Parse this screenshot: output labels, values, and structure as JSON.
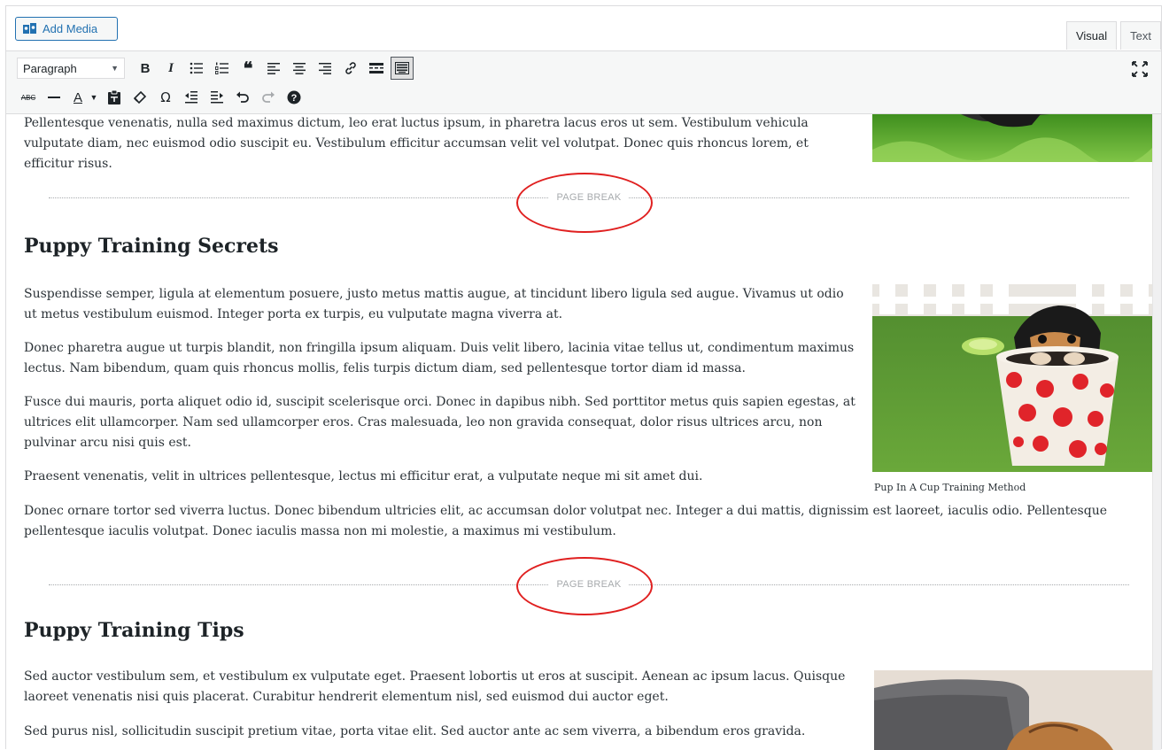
{
  "header": {
    "add_media_label": "Add Media",
    "tabs": [
      {
        "label": "Visual",
        "active": true
      },
      {
        "label": "Text",
        "active": false
      }
    ]
  },
  "toolbar": {
    "format_select": "Paragraph",
    "row1_icons": [
      "bold-icon",
      "italic-icon",
      "bulleted-list-icon",
      "numbered-list-icon",
      "blockquote-icon",
      "align-left-icon",
      "align-center-icon",
      "align-right-icon",
      "link-icon",
      "read-more-icon",
      "toolbar-toggle-icon"
    ],
    "row2_icons": [
      "strikethrough-icon",
      "horizontal-line-icon",
      "text-color-icon",
      "paste-as-text-icon",
      "clear-formatting-icon",
      "special-character-icon",
      "outdent-icon",
      "indent-icon",
      "undo-icon",
      "redo-icon",
      "help-icon"
    ],
    "bold": "B",
    "italic": "I",
    "strike": "ABC",
    "text_color": "A",
    "omega": "Ω",
    "help": "?"
  },
  "content": {
    "top_paragraph": "Pellentesque venenatis, nulla sed maximus dictum, leo erat luctus ipsum, in pharetra lacus eros ut sem. Vestibulum vehicula vulputate diam, nec euismod odio suscipit eu. Vestibulum efficitur accumsan velit vel volutpat. Donec quis rhoncus lorem, et efficitur risus.",
    "page_break_label": "PAGE BREAK",
    "section1": {
      "heading": "Puppy Training Secrets",
      "paragraphs": [
        "Suspendisse semper, ligula at elementum posuere, justo metus mattis augue, at tincidunt libero ligula sed augue. Vivamus ut odio ut metus vestibulum euismod. Integer porta ex turpis, eu vulputate magna viverra at.",
        "Donec pharetra augue ut turpis blandit, non fringilla ipsum aliquam. Duis velit libero, lacinia vitae tellus ut, condimentum maximus lectus. Nam bibendum, quam quis rhoncus mollis, felis turpis dictum diam, sed pellentesque tortor diam id massa.",
        "Fusce dui mauris, porta aliquet odio id, suscipit scelerisque orci. Donec in dapibus nibh. Sed porttitor metus quis sapien egestas, at ultrices elit ullamcorper. Nam sed ullamcorper eros. Cras malesuada, leo non gravida consequat, dolor risus ultrices arcu, non pulvinar arcu nisi quis est.",
        "Praesent venenatis, velit in ultrices pellentesque, lectus mi efficitur erat, a vulputate neque mi sit amet dui.",
        "Donec ornare tortor sed viverra luctus. Donec bibendum ultricies elit, ac accumsan dolor volutpat nec. Integer a dui mattis, dignissim est laoreet, iaculis odio. Pellentesque pellentesque iaculis volutpat. Donec iaculis massa non mi molestie, a maximus mi vestibulum."
      ],
      "image_caption": "Pup In A Cup Training Method"
    },
    "section2": {
      "heading": "Puppy Training Tips",
      "paragraphs": [
        "Sed auctor vestibulum sem, et vestibulum ex vulputate eget. Praesent lobortis ut eros at suscipit. Aenean ac ipsum lacus. Quisque laoreet venenatis nisi quis placerat. Curabitur hendrerit elementum nisl, sed euismod dui auctor eget.",
        "Sed purus nisl, sollicitudin suscipit pretium vitae, porta vitae elit. Sed auctor ante ac sem viverra, a bibendum eros gravida."
      ]
    }
  },
  "colors": {
    "annotation_circle": "#e02020",
    "accent": "#2271b1"
  }
}
